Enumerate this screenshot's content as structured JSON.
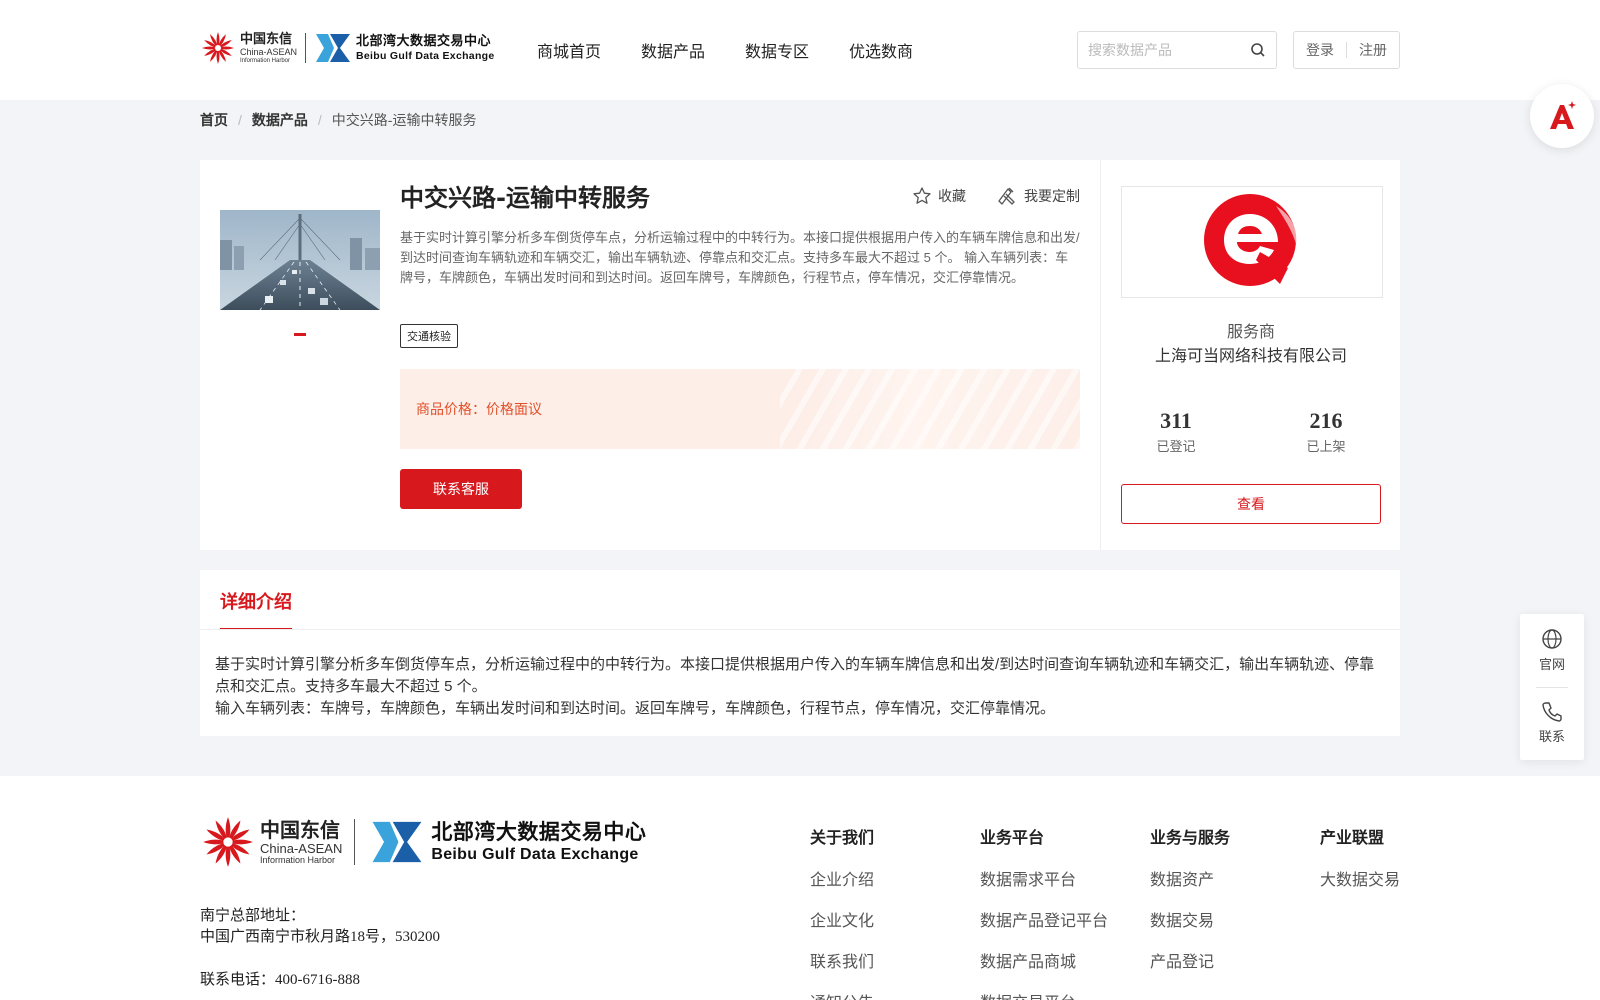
{
  "brand": {
    "cn_name": "中国东信",
    "cn_en": "China-ASEAN",
    "cn_sub": "Information Harbor",
    "bx_name": "北部湾大数据交易中心",
    "bx_en": "Beibu Gulf Data Exchange"
  },
  "nav": [
    "商城首页",
    "数据产品",
    "数据专区",
    "优选数商"
  ],
  "search": {
    "placeholder": "搜索数据产品",
    "icon": "search-icon"
  },
  "auth": {
    "login": "登录",
    "register": "注册"
  },
  "breadcrumb": [
    "首页",
    "数据产品",
    "中交兴路-运输中转服务"
  ],
  "product": {
    "title": "中交兴路-运输中转服务",
    "favorite": "收藏",
    "customize": "我要定制",
    "description": "基于实时计算引擎分析多车倒货停车点，分析运输过程中的中转行为。本接口提供根据用户传入的车辆车牌信息和出发/到达时间查询车辆轨迹和车辆交汇，输出车辆轨迹、停靠点和交汇点。支持多车最大不超过 5 个。 输入车辆列表：车牌号，车牌颜色，车辆出发时间和到达时间。返回车牌号，车牌颜色，行程节点，停车情况，交汇停靠情况。",
    "tag": "交通核验",
    "price_label": "商品价格：",
    "price_value": "价格面议",
    "contact_button": "联系客服"
  },
  "vendor": {
    "role": "服务商",
    "name": "上海可当网络科技有限公司",
    "registered_count": "311",
    "registered_label": "已登记",
    "listed_count": "216",
    "listed_label": "已上架",
    "view_button": "查看"
  },
  "detail": {
    "tab": "详细介绍",
    "line1": "基于实时计算引擎分析多车倒货停车点，分析运输过程中的中转行为。本接口提供根据用户传入的车辆车牌信息和出发/到达时间查询车辆轨迹和车辆交汇，输出车辆轨迹、停靠点和交汇点。支持多车最大不超过 5 个。",
    "line2": "输入车辆列表：车牌号，车牌颜色，车辆出发时间和到达时间。返回车牌号，车牌颜色，行程节点，停车情况，交汇停靠情况。"
  },
  "footer": {
    "address_label": "南宁总部地址：",
    "address": "中国广西南宁市秋月路18号，530200",
    "phone": "联系电话：400-6716-888",
    "columns": [
      {
        "title": "关于我们",
        "items": [
          "企业介绍",
          "企业文化",
          "联系我们",
          "通知公告"
        ]
      },
      {
        "title": "业务平台",
        "items": [
          "数据需求平台",
          "数据产品登记平台",
          "数据产品商城",
          "数据交易平台"
        ]
      },
      {
        "title": "业务与服务",
        "items": [
          "数据资产",
          "数据交易",
          "产品登记"
        ]
      },
      {
        "title": "产业联盟",
        "items": [
          "大数据交易"
        ]
      }
    ]
  },
  "side": {
    "website": "官网",
    "contact": "联系"
  },
  "colors": {
    "accent": "#d7191e",
    "price": "#e0502a",
    "background": "#f3f4f7"
  }
}
